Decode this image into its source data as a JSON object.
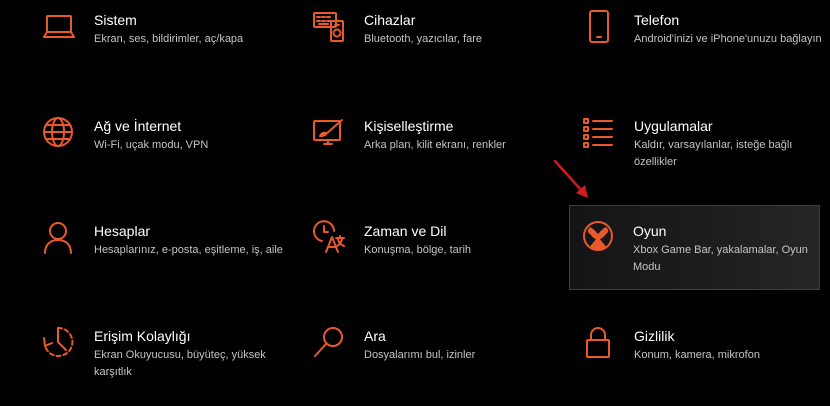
{
  "accent_color": "#e8592c",
  "tiles": [
    {
      "icon": "laptop-icon",
      "title": "Sistem",
      "desc": "Ekran, ses, bildirimler, aç/kapa"
    },
    {
      "icon": "devices-icon",
      "title": "Cihazlar",
      "desc": "Bluetooth, yazıcılar, fare"
    },
    {
      "icon": "phone-icon",
      "title": "Telefon",
      "desc": "Android'inizi ve iPhone'unuzu bağlayın"
    },
    {
      "icon": "globe-icon",
      "title": "Ağ ve İnternet",
      "desc": "Wi-Fi, uçak modu, VPN"
    },
    {
      "icon": "personalization-icon",
      "title": "Kişiselleştirme",
      "desc": "Arka plan, kilit ekranı, renkler"
    },
    {
      "icon": "apps-list-icon",
      "title": "Uygulamalar",
      "desc": "Kaldır, varsayılanlar, isteğe bağlı özellikler"
    },
    {
      "icon": "person-icon",
      "title": "Hesaplar",
      "desc": "Hesaplarınız, e-posta, eşitleme, iş, aile"
    },
    {
      "icon": "time-language-icon",
      "title": "Zaman ve Dil",
      "desc": "Konuşma, bölge, tarih"
    },
    {
      "icon": "xbox-icon",
      "title": "Oyun",
      "desc": "Xbox Game Bar, yakalamalar, Oyun Modu"
    },
    {
      "icon": "accessibility-icon",
      "title": "Erişim Kolaylığı",
      "desc": "Ekran Okuyucusu, büyüteç, yüksek karşıtlık"
    },
    {
      "icon": "search-icon",
      "title": "Ara",
      "desc": "Dosyalarımı bul, izinler"
    },
    {
      "icon": "lock-icon",
      "title": "Gizlilik",
      "desc": "Konum, kamera, mikrofon"
    }
  ]
}
